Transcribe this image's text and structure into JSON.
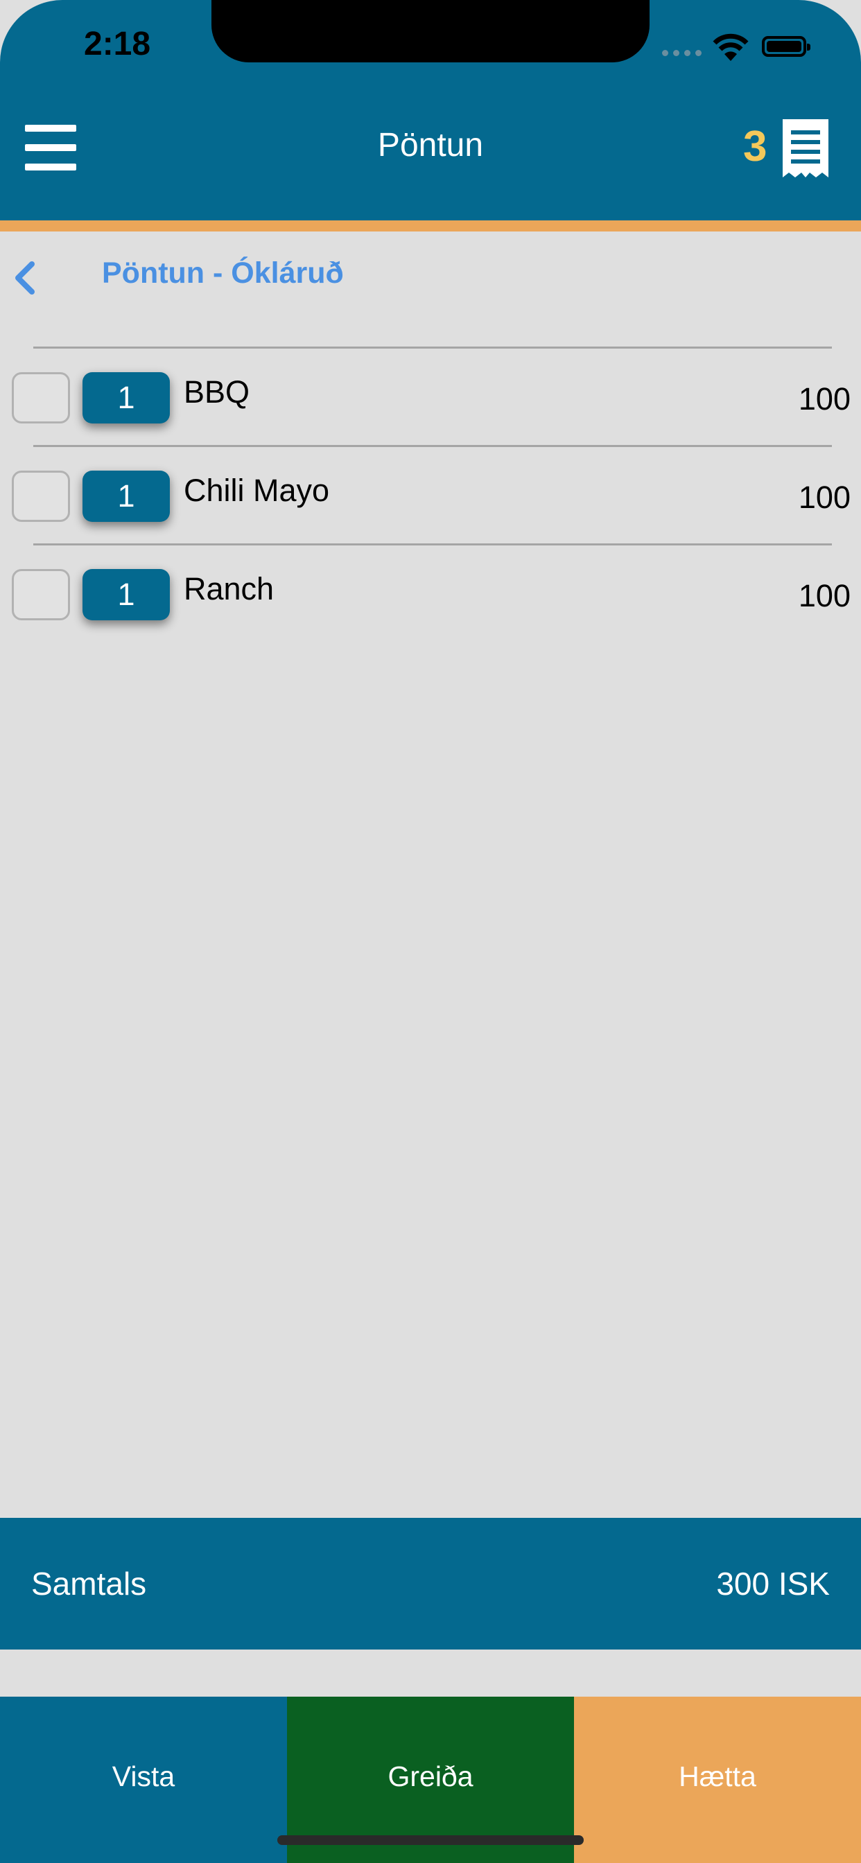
{
  "status_bar": {
    "time": "2:18"
  },
  "header": {
    "title": "Pöntun",
    "cart_count": "3"
  },
  "subheader": {
    "title": "Pöntun - Ókláruð"
  },
  "items": [
    {
      "qty": "1",
      "name": "BBQ",
      "price": "100"
    },
    {
      "qty": "1",
      "name": "Chili Mayo",
      "price": "100"
    },
    {
      "qty": "1",
      "name": "Ranch",
      "price": "100"
    }
  ],
  "total": {
    "label": "Samtals",
    "value": "300 ISK"
  },
  "actions": {
    "save": "Vista",
    "pay": "Greiða",
    "cancel": "Hætta"
  },
  "colors": {
    "primary": "#04698f",
    "accent": "#eba659",
    "pay": "#0a6021",
    "badge": "#f4c85a",
    "link": "#4a90e2"
  }
}
